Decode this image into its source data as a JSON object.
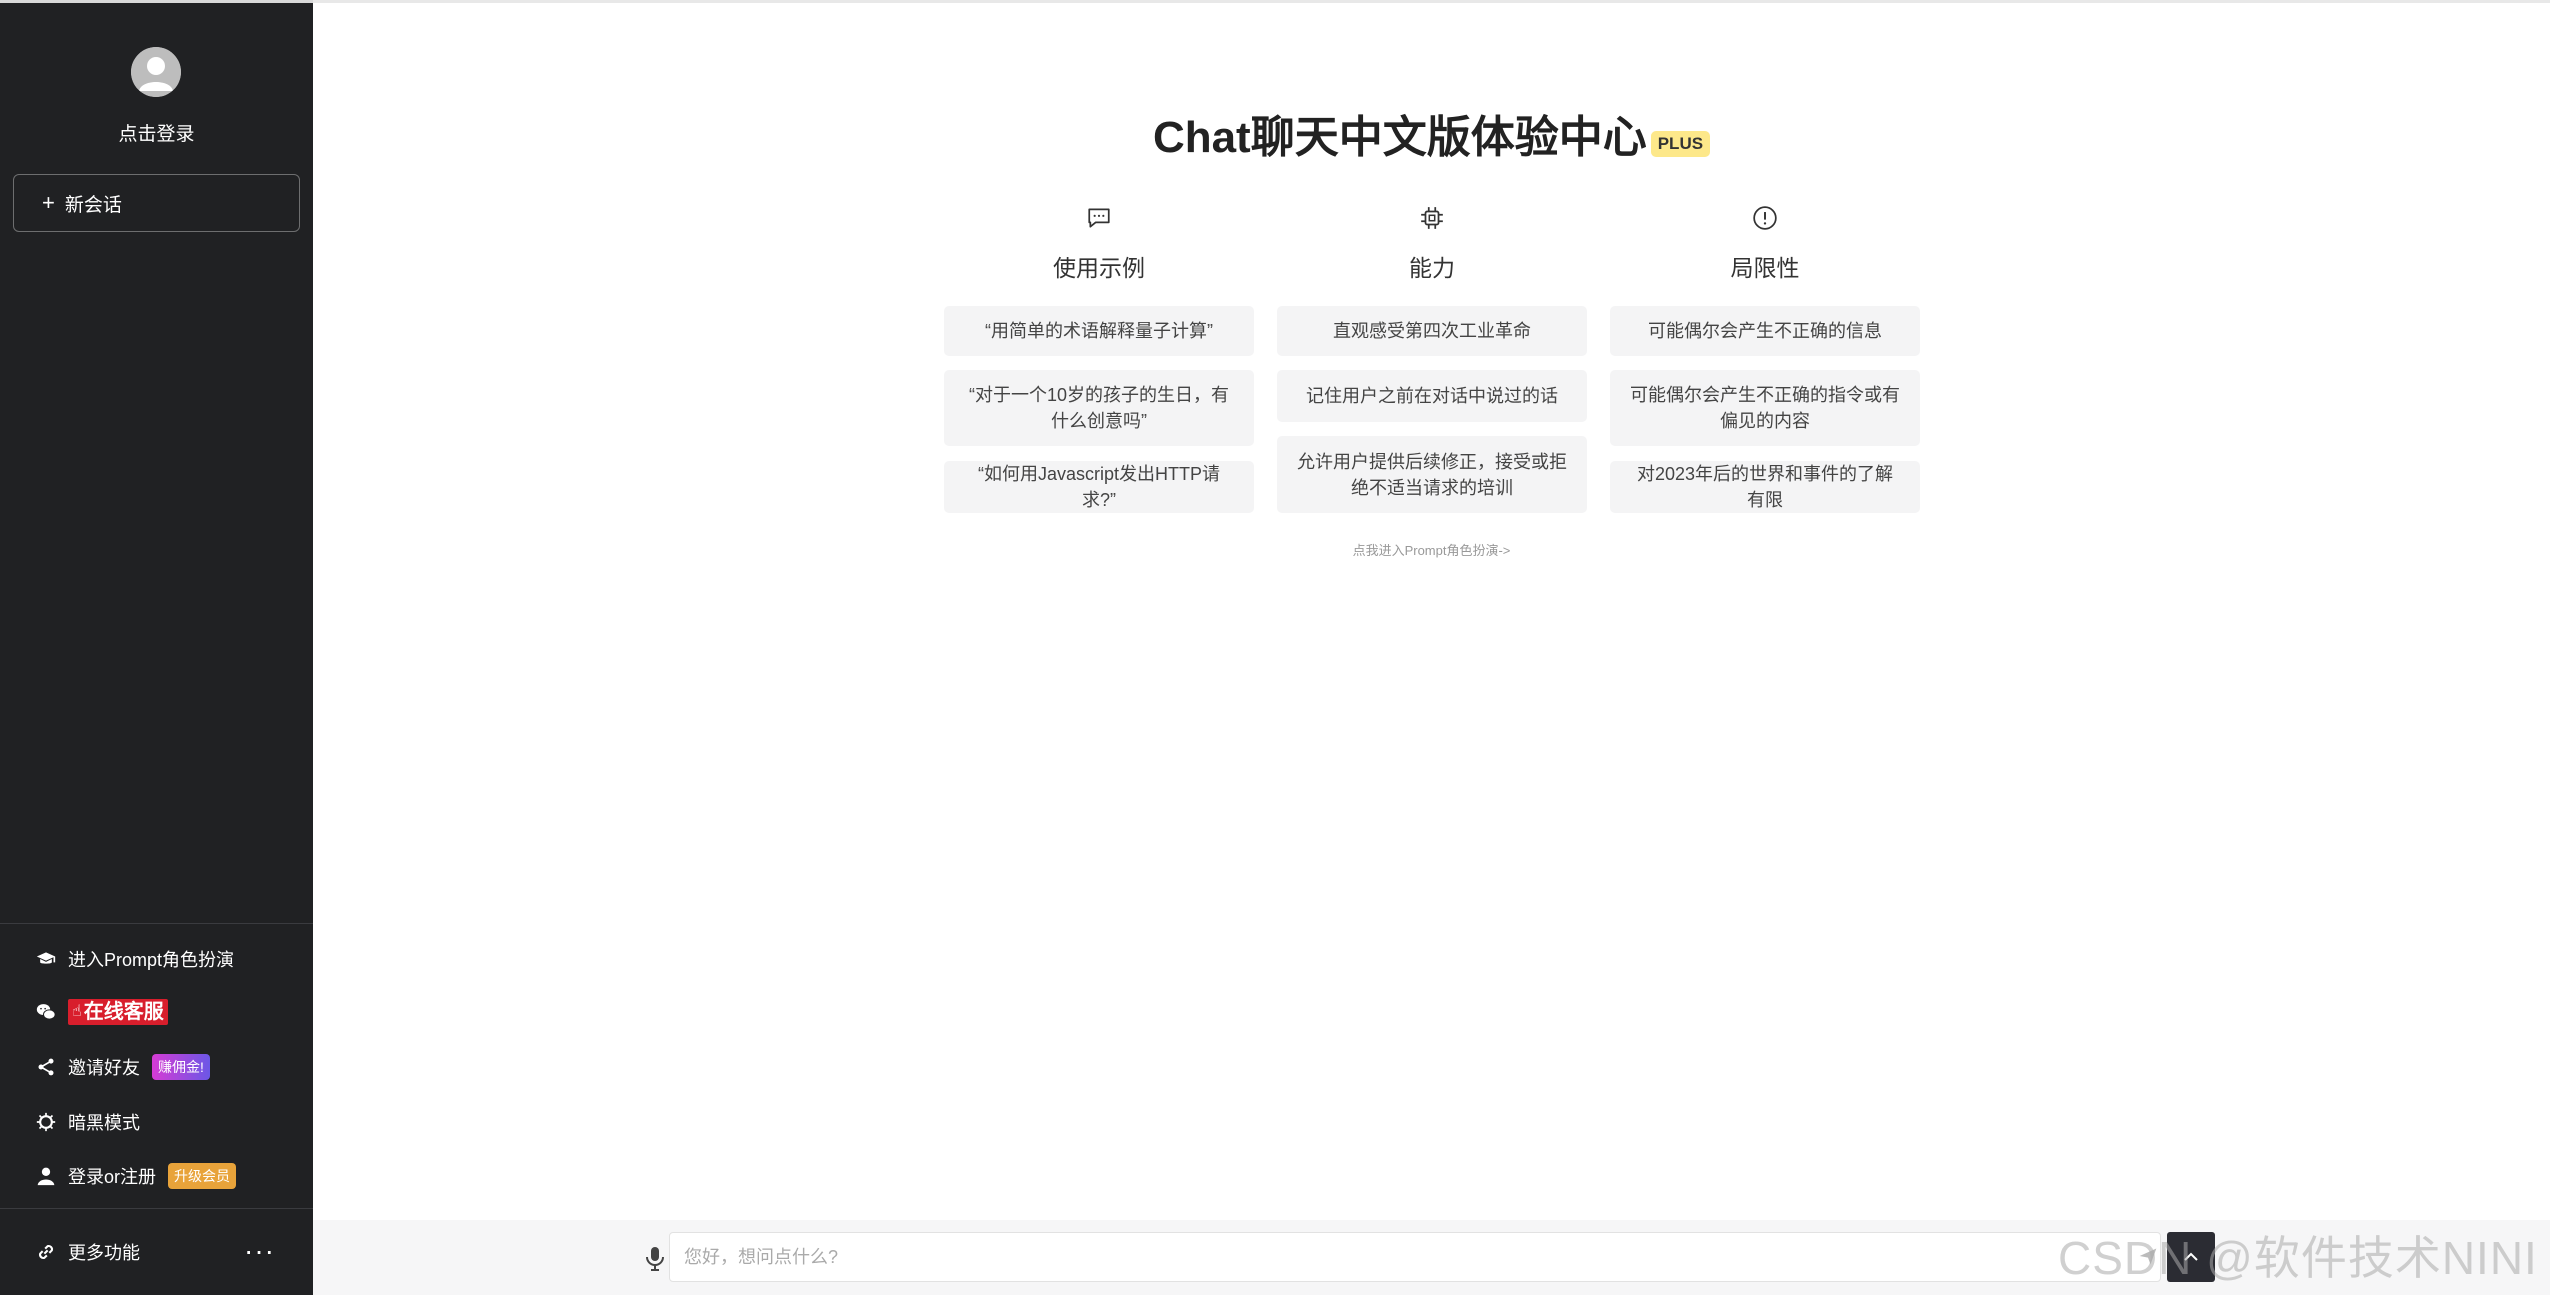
{
  "sidebar": {
    "login_text": "点击登录",
    "new_chat": "新会话",
    "new_chat_icon": "plus-icon",
    "items": [
      {
        "label": "进入Prompt角色扮演",
        "icon": "graduation-cap-icon"
      },
      {
        "label": "在线客服",
        "icon": "wechat-icon"
      },
      {
        "label": "邀请好友",
        "icon": "share-icon",
        "badge": "赚佣金!"
      },
      {
        "label": "暗黑模式",
        "icon": "gear-icon"
      },
      {
        "label": "登录or注册",
        "icon": "user-icon",
        "badge": "升级会员"
      }
    ],
    "more": {
      "label": "更多功能",
      "icon": "link-icon",
      "dots": "···"
    }
  },
  "main": {
    "title": "Chat聊天中文版体验中心",
    "title_badge": "PLUS",
    "columns": [
      {
        "title": "使用示例",
        "icon": "chat-bubble-icon",
        "cards": [
          "“用简单的术语解释量子计算”",
          "“对于一个10岁的孩子的生日，有什么创意吗”",
          "“如何用Javascript发出HTTP请求?”"
        ]
      },
      {
        "title": "能力",
        "icon": "chip-icon",
        "cards": [
          "直观感受第四次工业革命",
          "记住用户之前在对话中说过的话",
          "允许用户提供后续修正，接受或拒绝不适当请求的培训"
        ]
      },
      {
        "title": "局限性",
        "icon": "warning-circle-icon",
        "cards": [
          "可能偶尔会产生不正确的信息",
          "可能偶尔会产生不正确的指令或有偏见的内容",
          "对2023年后的世界和事件的了解有限"
        ]
      }
    ],
    "prompt_link": "点我进入Prompt角色扮演->"
  },
  "input": {
    "placeholder": "您好，想问点什么?"
  },
  "watermark": "CSDN @软件技术NINI",
  "colors": {
    "sidebar_bg": "#202123",
    "plus_badge": "#fde88a",
    "service_red": "#d81e2c",
    "badge_orange": "#e8a33a"
  }
}
